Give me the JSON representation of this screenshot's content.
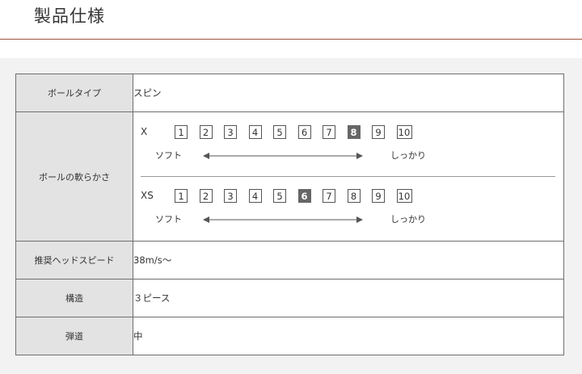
{
  "header": {
    "title": "製品仕様"
  },
  "spec": {
    "ball_type": {
      "label": "ボールタイプ",
      "value": "スピン"
    },
    "softness": {
      "label": "ボールの軟らかさ",
      "models": [
        {
          "name": "X",
          "scale": [
            "1",
            "2",
            "3",
            "4",
            "5",
            "6",
            "7",
            "8",
            "9",
            "10"
          ],
          "selected": "8"
        },
        {
          "name": "XS",
          "scale": [
            "1",
            "2",
            "3",
            "4",
            "5",
            "6",
            "7",
            "8",
            "9",
            "10"
          ],
          "selected": "6"
        }
      ],
      "soft_label": "ソフト",
      "firm_label": "しっかり"
    },
    "head_speed": {
      "label": "推奨ヘッドスピード",
      "value": "38m/s〜"
    },
    "construction": {
      "label": "構造",
      "value": "３ピース"
    },
    "trajectory": {
      "label": "弾道",
      "value": "中"
    }
  }
}
